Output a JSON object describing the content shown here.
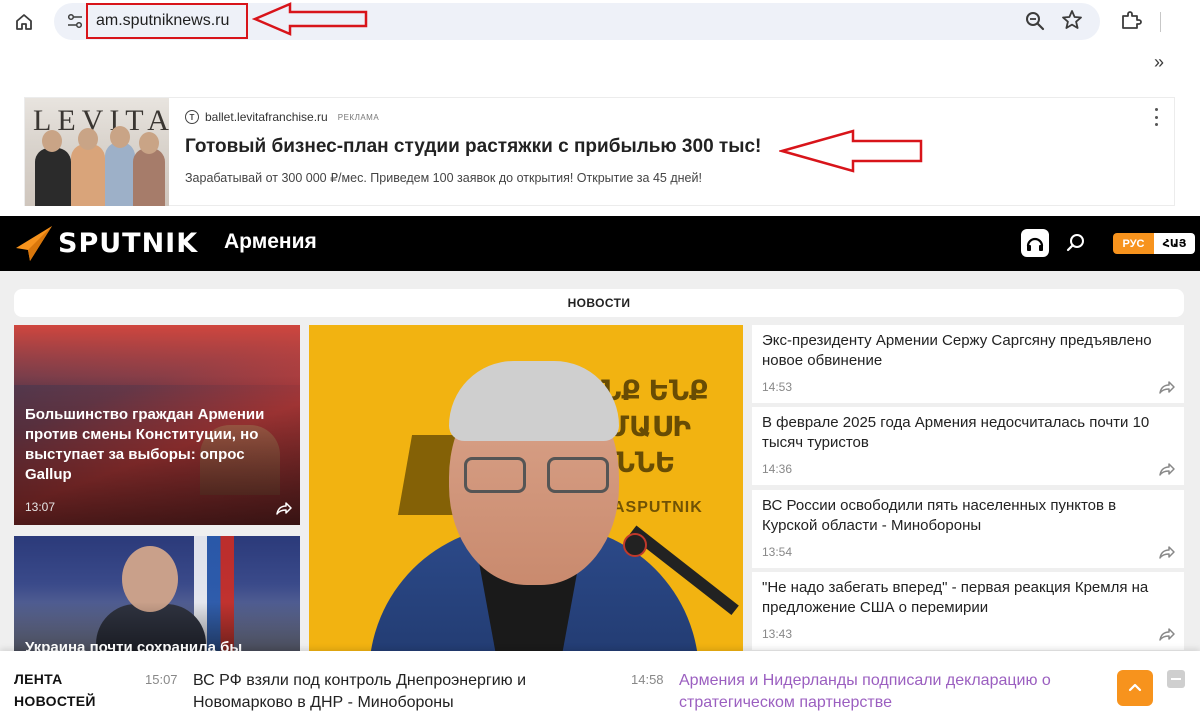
{
  "browser": {
    "url": "am.sputniknews.ru",
    "bookmarks_more": "»"
  },
  "ad": {
    "image_logo_text": "LEVITA",
    "domain": "ballet.levitafranchise.ru",
    "label": "РЕКЛАМА",
    "favicon_letter": "T",
    "headline": "Готовый бизнес-план студии растяжки с прибылью 300 тыс!",
    "description": "Зарабатывай от 300 000 ₽/мес. Приведем 100 заявок до открытия! Открытие за 45 дней!"
  },
  "header": {
    "brand": "SPUTNIK",
    "region": "Армения",
    "lang_active": "РУС",
    "lang_other": "ՀԱՅ"
  },
  "news_tab": "НОВОСТИ",
  "cards": [
    {
      "title": "Большинство граждан Армении против смены Конституции, но выступает за выборы: опрос Gallup",
      "time": "13:07"
    },
    {
      "title": "Украина почти сохранила бы"
    }
  ],
  "main_photo": {
    "backdrop_text": "ՄԵՆՔ ԵՆՔ ՄԻ ՄԱՍԻ ՅՈՒՆՆԵ",
    "backdrop_text_2": "MEDIASPUTNIK"
  },
  "news_list": [
    {
      "title": "Экс-президенту Армении Сержу Саргсяну предъявлено новое обвинение",
      "time": "14:53"
    },
    {
      "title": "В феврале 2025 года Армения недосчиталась почти 10 тысяч туристов",
      "time": "14:36"
    },
    {
      "title": "ВС России освободили пять населенных пунктов в Курской области - Минобороны",
      "time": "13:54"
    },
    {
      "title": "\"Не надо забегать вперед\" - первая реакция Кремля на предложение США о перемирии",
      "time": "13:43"
    }
  ],
  "ticker": {
    "label_line1": "ЛЕНТА",
    "label_line2": "НОВОСТЕЙ",
    "items": [
      {
        "time": "15:07",
        "text": "ВС РФ взяли под контроль Днепроэнергию и Новомарково в ДНР - Минобороны"
      },
      {
        "time": "14:58",
        "text": "Армения и Нидерланды подписали декларацию о стратегическом партнерстве"
      }
    ]
  },
  "colors": {
    "sputnik_orange": "#f7931d",
    "annotation_red": "#d8141a",
    "header_bg": "#000000",
    "ticker_accent": "#9b5fc0"
  },
  "icons": [
    "home-icon",
    "site-info-icon",
    "zoom-icon",
    "star-icon",
    "extensions-icon",
    "radio-icon",
    "search-icon",
    "share-icon",
    "arrow-up-icon",
    "collapse-icon"
  ]
}
